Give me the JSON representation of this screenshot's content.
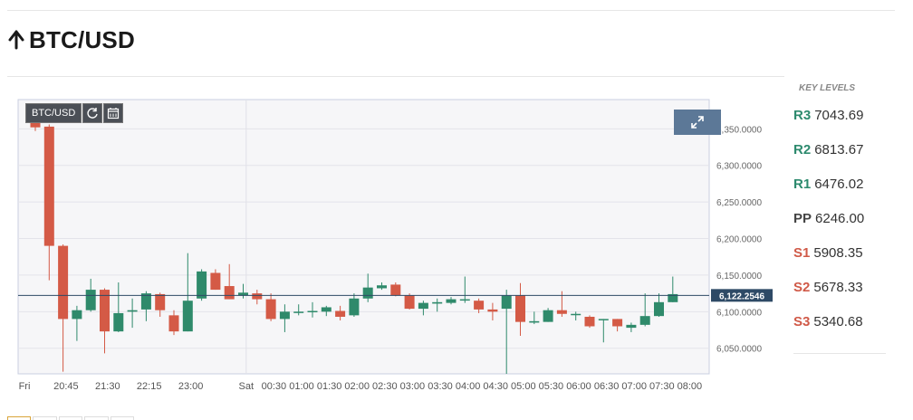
{
  "page": {
    "title": "BTC/USD",
    "trend_icon": "arrow-up-icon"
  },
  "toolbar": {
    "symbol_label": "BTC/USD",
    "refresh_icon": "refresh-icon",
    "calendar_icon": "calendar-icon",
    "expand_icon": "expand-icon"
  },
  "key_levels": {
    "title": "KEY LEVELS",
    "levels": [
      {
        "name": "R3",
        "value": "7043.69",
        "color": "#2d8a6e"
      },
      {
        "name": "R2",
        "value": "6813.67",
        "color": "#2d8a6e"
      },
      {
        "name": "R1",
        "value": "6476.02",
        "color": "#2d8a6e"
      },
      {
        "name": "PP",
        "value": "6246.00",
        "color": "#444444"
      },
      {
        "name": "S1",
        "value": "5908.35",
        "color": "#d05a48"
      },
      {
        "name": "S2",
        "value": "5678.33",
        "color": "#d05a48"
      },
      {
        "name": "S3",
        "value": "5340.68",
        "color": "#d05a48"
      }
    ]
  },
  "chart_data": {
    "type": "candlestick",
    "symbol": "BTC/USD",
    "ylim": [
      6015,
      6390
    ],
    "yticks": [
      6050,
      6100,
      6150,
      6200,
      6250,
      6300,
      6350
    ],
    "ytick_labels": [
      "6,050.0000",
      "6,100.0000",
      "6,150.0000",
      "6,200.0000",
      "6,250.0000",
      "6,300.0000",
      "6,350.0000"
    ],
    "last_price": 6122.2546,
    "last_price_label": "6,122.2546",
    "grid": true,
    "colors": {
      "up": "#2f8a6b",
      "down": "#d45a46",
      "price_line": "#2e4a66"
    },
    "x_labels": [
      "Fri",
      "20:45",
      "21:30",
      "22:15",
      "23:00",
      "Sat",
      "00:30",
      "01:00",
      "01:30",
      "02:00",
      "02:30",
      "03:00",
      "03:30",
      "04:00",
      "04:30",
      "05:00",
      "05:30",
      "06:00",
      "06:30",
      "07:00",
      "07:30",
      "08:00"
    ],
    "x_label_slots": [
      0,
      3,
      6,
      9,
      12,
      16,
      18,
      20,
      22,
      24,
      26,
      28,
      30,
      32,
      34,
      36,
      38,
      40,
      42,
      44,
      46,
      48
    ],
    "divider_slot": 16,
    "candles": [
      [
        6368,
        6376,
        6347,
        6352
      ],
      [
        6353,
        6356,
        6143,
        6190
      ],
      [
        6190,
        6192,
        6018,
        6090
      ],
      [
        6090,
        6108,
        6060,
        6102
      ],
      [
        6102,
        6145,
        6100,
        6130
      ],
      [
        6130,
        6132,
        6043,
        6073
      ],
      [
        6073,
        6140,
        6072,
        6098
      ],
      [
        6100,
        6118,
        6078,
        6102
      ],
      [
        6103,
        6128,
        6087,
        6125
      ],
      [
        6124,
        6126,
        6093,
        6102
      ],
      [
        6095,
        6102,
        6068,
        6073
      ],
      [
        6073,
        6180,
        6073,
        6115
      ],
      [
        6118,
        6158,
        6115,
        6155
      ],
      [
        6153,
        6158,
        6130,
        6130
      ],
      [
        6135,
        6165,
        6117,
        6117
      ],
      [
        6122,
        6138,
        6118,
        6126
      ],
      [
        6125,
        6130,
        6110,
        6117
      ],
      [
        6117,
        6125,
        6087,
        6090
      ],
      [
        6090,
        6110,
        6072,
        6100
      ],
      [
        6100,
        6110,
        6095,
        6100
      ],
      [
        6101,
        6113,
        6092,
        6101
      ],
      [
        6100,
        6108,
        6094,
        6106
      ],
      [
        6101,
        6108,
        6088,
        6093
      ],
      [
        6095,
        6125,
        6093,
        6118
      ],
      [
        6118,
        6152,
        6113,
        6133
      ],
      [
        6132,
        6140,
        6130,
        6136
      ],
      [
        6137,
        6140,
        6121,
        6122
      ],
      [
        6122,
        6125,
        6103,
        6104
      ],
      [
        6104,
        6115,
        6095,
        6112
      ],
      [
        6111,
        6118,
        6100,
        6113
      ],
      [
        6112,
        6120,
        6110,
        6117
      ],
      [
        6116,
        6148,
        6112,
        6117
      ],
      [
        6115,
        6118,
        6098,
        6103
      ],
      [
        6103,
        6112,
        6088,
        6100
      ],
      [
        6104,
        6130,
        6010,
        6122
      ],
      [
        6122,
        6139,
        6067,
        6086
      ],
      [
        6085,
        6100,
        6083,
        6087
      ],
      [
        6086,
        6105,
        6086,
        6102
      ],
      [
        6102,
        6128,
        6093,
        6097
      ],
      [
        6097,
        6100,
        6088,
        6097
      ],
      [
        6093,
        6095,
        6078,
        6080
      ],
      [
        6090,
        6090,
        6058,
        6090
      ],
      [
        6090,
        6090,
        6073,
        6080
      ],
      [
        6078,
        6085,
        6072,
        6082
      ],
      [
        6082,
        6125,
        6080,
        6094
      ],
      [
        6094,
        6125,
        6093,
        6113
      ],
      [
        6113,
        6148,
        6113,
        6124
      ]
    ]
  }
}
